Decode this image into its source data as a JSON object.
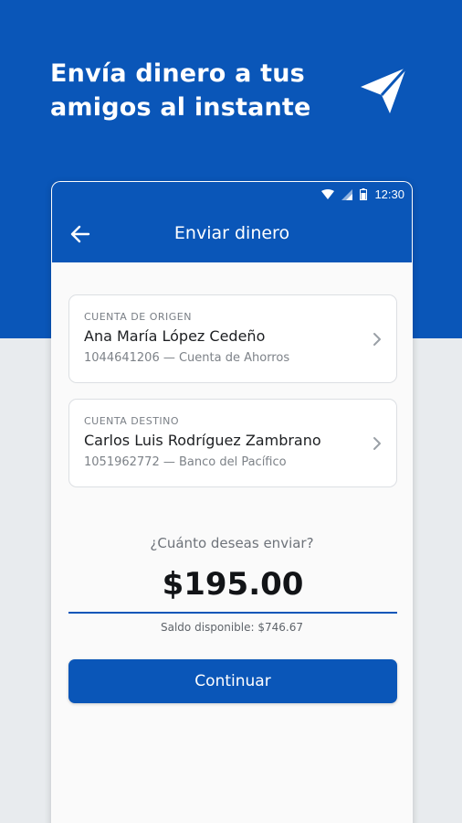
{
  "hero": {
    "title": "Envía dinero a tus amigos al instante",
    "icon": "paper-plane-icon"
  },
  "statusbar": {
    "time": "12:30",
    "icons": [
      "wifi-icon",
      "signal-icon",
      "battery-icon"
    ]
  },
  "appbar": {
    "title": "Enviar dinero",
    "back_icon": "arrow-left-icon"
  },
  "origin_account": {
    "label": "CUENTA DE ORIGEN",
    "name": "Ana María López Cedeño",
    "detail": "1044641206 — Cuenta de Ahorros"
  },
  "destination_account": {
    "label": "CUENTA DESTINO",
    "name": "Carlos Luis Rodríguez Zambrano",
    "detail": "1051962772 — Banco del Pacífico"
  },
  "amount_section": {
    "question": "¿Cuánto deseas enviar?",
    "amount": "$195.00",
    "balance": "Saldo disponible: $746.67"
  },
  "actions": {
    "continue_label": "Continuar"
  },
  "colors": {
    "brand_blue": "#0a56b8",
    "background_gray": "#e8ebee",
    "card_border": "#dcdfe3"
  }
}
